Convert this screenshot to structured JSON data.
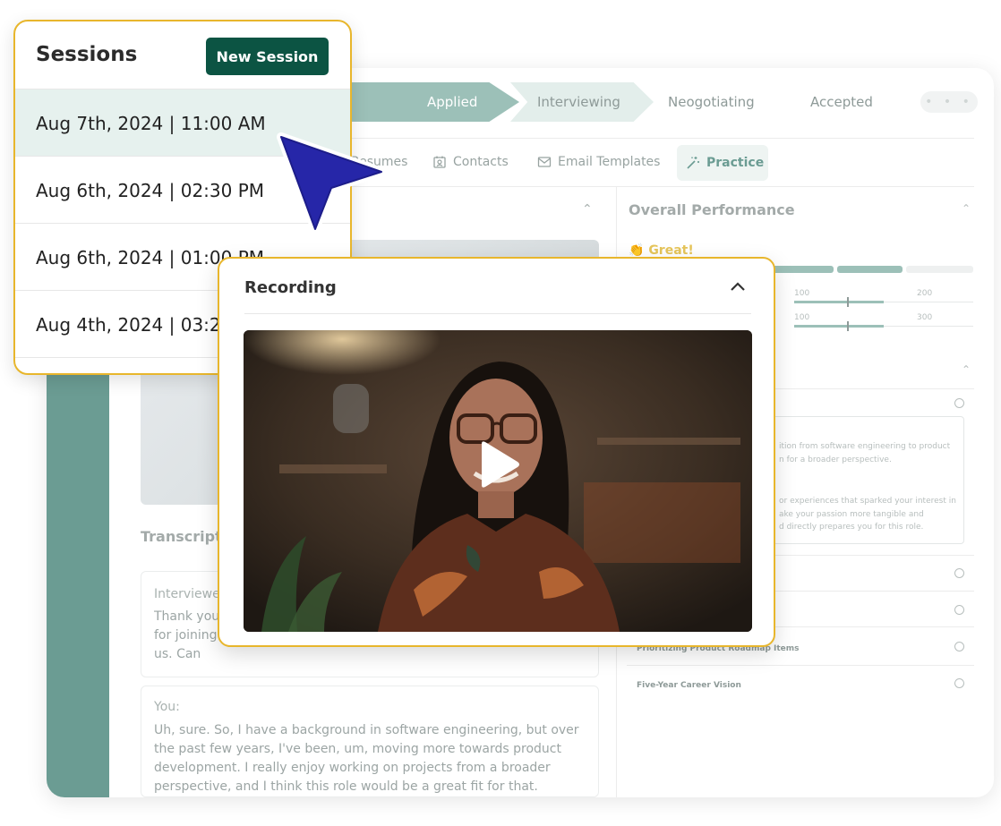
{
  "stepper": {
    "steps": [
      "Applied",
      "Interviewing",
      "Neogotiating",
      "Accepted"
    ],
    "more": "• • •"
  },
  "tabs": {
    "resumes": "Resumes",
    "contacts": "Contacts",
    "email_templates": "Email Templates",
    "practice": "Practice"
  },
  "performance": {
    "title": "Overall Performance",
    "rating": "Great!",
    "scale_labels": [
      "100",
      "200",
      "100",
      "300"
    ]
  },
  "feedback": {
    "lines": [
      "ition from software engineering to product",
      "n for a broader perspective.",
      "or experiences that sparked your interest in",
      "ake your passion more tangible and",
      "d directly prepares you for this role."
    ],
    "questions": [
      "Prioritizing Product Roadmap Items",
      "Five-Year Career Vision"
    ]
  },
  "transcript": {
    "title": "Transcript",
    "messages": [
      {
        "speaker": "Interviewer:",
        "text": "Thank you for joining us. Can you tell me about your background and why you're interested in this position?"
      },
      {
        "speaker": "You:",
        "text": "Uh, sure. So, I have a background in software engineering, but over the past few years, I've been, um, moving more towards product development. I really enjoy working on projects from a broader perspective, and I think this role would be a great fit for that."
      }
    ]
  },
  "sessions": {
    "title": "Sessions",
    "new_button": "New Session",
    "items": [
      "Aug 7th, 2024 | 11:00 AM",
      "Aug 6th, 2024 | 02:30 PM",
      "Aug 6th, 2024 | 01:00 PM",
      "Aug 4th, 2024 | 03:2"
    ]
  },
  "recording": {
    "title": "Recording"
  },
  "colors": {
    "accent": "#6b9c93",
    "primary_button": "#0c5443",
    "highlight_border": "#e8b62c",
    "cursor": "#2626a8"
  }
}
